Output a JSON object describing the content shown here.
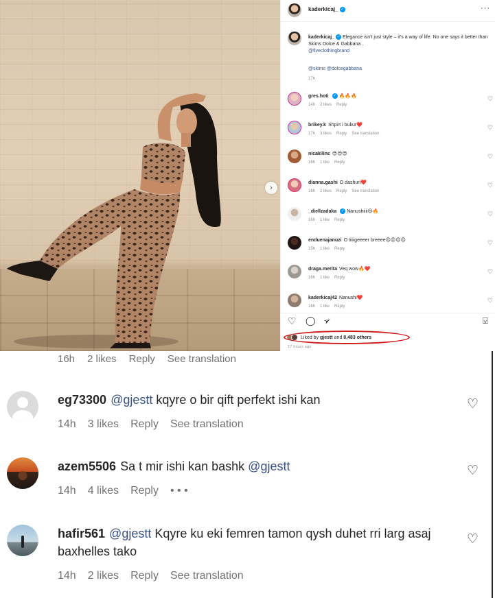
{
  "post": {
    "username": "kaderkicaj_",
    "more_label": "···",
    "caption_text": "Elegance isn't just style – it's a way of life. No one says it better than Skims Dolce & Gabbana .",
    "caption_mention": "@fiveclothingbrand",
    "caption_tags": "@skims @dolcegabbana",
    "caption_time": "17h",
    "carousel_next_icon": "›",
    "comments": [
      {
        "user": "gres.hoti",
        "verified": true,
        "text": "🔥🔥🔥",
        "time": "14h",
        "likes": "2 likes",
        "reply": "Reply",
        "translate": ""
      },
      {
        "user": "brikey.k",
        "verified": false,
        "text": "Shpirt i bukur❤️",
        "time": "17h",
        "likes": "3 likes",
        "reply": "Reply",
        "translate": "See translation"
      },
      {
        "user": "nicakilinc",
        "verified": false,
        "text": "😍😍😍",
        "time": "16h",
        "likes": "1 like",
        "reply": "Reply",
        "translate": ""
      },
      {
        "user": "dianna.gashi",
        "verified": false,
        "text": "O dashuri❤️",
        "time": "16h",
        "likes": "2 likes",
        "reply": "Reply",
        "translate": "See translation"
      },
      {
        "user": "_diellzadaka",
        "verified": true,
        "text": "Nanushiiii😍🔥",
        "time": "16h",
        "likes": "1 like",
        "reply": "Reply",
        "translate": ""
      },
      {
        "user": "enduenajanuzi",
        "verified": false,
        "text": "O tiiiigeeeer breeee😍😍😍😍",
        "time": "15h",
        "likes": "1 like",
        "reply": "Reply",
        "translate": ""
      },
      {
        "user": "draga.merita",
        "verified": false,
        "text": "Veq wow🔥❤️",
        "time": "16h",
        "likes": "1 like",
        "reply": "Reply",
        "translate": ""
      },
      {
        "user": "kaderkicaj42",
        "verified": false,
        "text": "Nanushi❤️",
        "time": "16h",
        "likes": "1 like",
        "reply": "Reply",
        "translate": ""
      }
    ],
    "icons": {
      "like": "♡",
      "comment": "◯",
      "share": "➢",
      "save": "⍌"
    },
    "likes_prefix": "Liked by",
    "likes_user": "gjestt",
    "likes_and": "and",
    "likes_count": "8,483 others",
    "ago": "17 hours ago"
  },
  "enlarged": {
    "strip": {
      "time": "16h",
      "likes": "2 likes",
      "reply": "Reply",
      "translate": "See translation"
    },
    "comments": [
      {
        "user": "eg73300",
        "mention": "@gjestt",
        "text": "kqyre o bir qift perfekt ishi kan",
        "time": "14h",
        "likes": "3 likes",
        "reply": "Reply",
        "extra": "See translation"
      },
      {
        "user": "azem5506",
        "text_before": "Sa t mir ishi kan bashk",
        "mention": "@gjestt",
        "time": "14h",
        "likes": "4 likes",
        "reply": "Reply",
        "extra": "• • •"
      },
      {
        "user": "hafir561",
        "mention": "@gjestt",
        "text": "Kqyre ku eki femren tamon qysh duhet rri larg asaj baxhelles tako",
        "time": "14h",
        "likes": "2 likes",
        "reply": "Reply",
        "extra": "See translation"
      }
    ],
    "heart_icon": "♡"
  }
}
